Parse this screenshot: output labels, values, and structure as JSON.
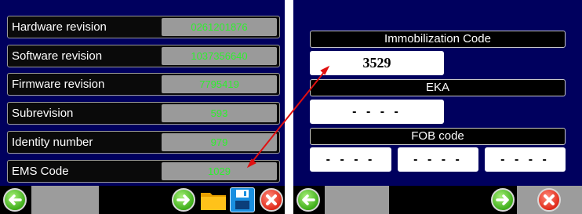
{
  "left_panel": {
    "rows": [
      {
        "label": "Hardware revision",
        "value": "0261201876"
      },
      {
        "label": "Software revision",
        "value": "1037356640"
      },
      {
        "label": "Firmware revision",
        "value": "7795419"
      },
      {
        "label": "Subrevision",
        "value": "593"
      },
      {
        "label": "Identity number",
        "value": "979"
      },
      {
        "label": "EMS Code",
        "value": "1029"
      }
    ],
    "toolbar": {
      "back_icon": "back-arrow-icon",
      "forward_icon": "forward-arrow-icon",
      "folder_icon": "folder-icon",
      "save_icon": "floppy-disk-icon",
      "close_icon": "close-x-icon"
    }
  },
  "right_panel": {
    "immobilization": {
      "label": "Immobilization Code",
      "value": "3529"
    },
    "eka": {
      "label": "EKA",
      "value": "- - - -"
    },
    "fob": {
      "label": "FOB code",
      "values": [
        "- - - -",
        "- - - -",
        "- - - -"
      ]
    },
    "toolbar": {
      "back_icon": "back-arrow-icon",
      "forward_icon": "forward-arrow-icon",
      "close_icon": "close-x-icon"
    }
  },
  "colors": {
    "panel_bg": "#00005e",
    "value_text": "#2ef02e",
    "value_bg": "#9a9a9a",
    "arrow": "#e01010"
  }
}
